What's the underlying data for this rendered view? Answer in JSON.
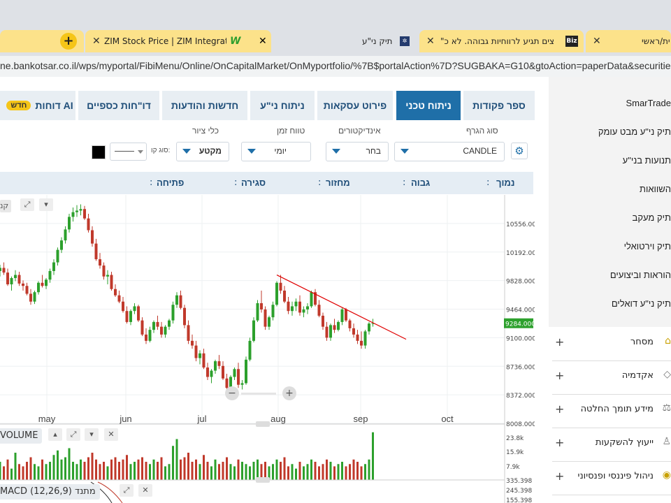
{
  "browser": {
    "tabs": [
      {
        "label": "ZIM Stock Price | ZIM Integrated",
        "icon": "w-logo-icon"
      },
      {
        "label": "תיק ני\"ע",
        "icon": "bank-logo-icon"
      },
      {
        "label": "\"צים תגיע לרווחיות גבוהה. לא כ",
        "icon": "biz-logo-icon",
        "icon_text": "Biz"
      },
      {
        "label": "ית/ראשי"
      }
    ],
    "new_tab": "+",
    "url": "ne.bankotsar.co.il/wps/myportal/FibiMenu/Online/OnCapitalMarket/OnMyportfolio/%7B$portalAction%7D?SUGBAKA=G10&gtoAction=paperData&securities"
  },
  "sidebar": {
    "links": [
      "SmarTrade",
      "תיק ני\"ע מבט עומק",
      "תנועות בני\"ע",
      "השוואות",
      "תיק מעקב",
      "תיק וירטואלי",
      "הוראות וביצועים",
      "תיק ני\"ע דואלים"
    ],
    "sections": [
      "מסחר",
      "אקדמיה",
      "מידע תומך החלטה",
      "ייעוץ להשקעות",
      "ניהול פיננסי ופנסיוני"
    ]
  },
  "main_tabs": [
    {
      "label": "ספר פקודות",
      "active": false
    },
    {
      "label": "ניתוח טכני",
      "active": true
    },
    {
      "label": "פירוט עסקאות",
      "active": false
    },
    {
      "label": "ניתוח ני\"ע",
      "active": false
    },
    {
      "label": "חדשות והודעות",
      "active": false
    },
    {
      "label": "דו\"חות כספיים",
      "active": false
    },
    {
      "label": "דוחות AI",
      "active": false,
      "badge": "חדש"
    }
  ],
  "controls": {
    "chart_type_label": "סוג הגרף",
    "chart_type_value": "CANDLE",
    "indicators_label": "אינדיקטורים",
    "indicators_value": "בחר",
    "timeframe_label": "טווח זמן",
    "timeframe_value": "יומי",
    "draw_tool_label": "כלי ציור",
    "draw_tool_value": "מקטע",
    "line_type_label": "סוג קו:",
    "line_color": "#000000"
  },
  "info_bar": {
    "symbol_label": "נמוך",
    "high_label": "גבוה",
    "volume_label": "מחזור",
    "close_label": "סגירה",
    "open_label": "פתיחה"
  },
  "chart_data": {
    "type": "candlestick",
    "price_ticks": [
      "10556.00",
      "10192.00",
      "9828.000",
      "9464.000",
      "9100.000",
      "8736.000",
      "8372.000",
      "8008.000"
    ],
    "price_ylim": [
      8008,
      10920
    ],
    "x_ticks": [
      "may",
      "jun",
      "jul",
      "aug",
      "sep",
      "oct"
    ],
    "last_price": "9284.000",
    "up_color": "#2ca02c",
    "down_color": "#c0392b",
    "trendline_color": "#e00000",
    "trendline": {
      "from": {
        "date": "jul 29",
        "price": 9900
      },
      "to": {
        "date": "sep 18",
        "price": 9080
      }
    },
    "series": [
      {
        "name": "price",
        "candles": [
          [
            9950,
            10030,
            9880,
            9990
          ],
          [
            9990,
            10060,
            9900,
            9930
          ],
          [
            9930,
            9980,
            9760,
            9780
          ],
          [
            9780,
            9880,
            9700,
            9860
          ],
          [
            9860,
            9960,
            9820,
            9900
          ],
          [
            9900,
            9940,
            9760,
            9790
          ],
          [
            9790,
            9830,
            9700,
            9760
          ],
          [
            9760,
            9800,
            9640,
            9660
          ],
          [
            9660,
            9720,
            9520,
            9560
          ],
          [
            9560,
            9700,
            9530,
            9680
          ],
          [
            9680,
            9820,
            9650,
            9800
          ],
          [
            9800,
            9900,
            9740,
            9760
          ],
          [
            9760,
            9860,
            9720,
            9840
          ],
          [
            9840,
            9980,
            9800,
            9950
          ],
          [
            9950,
            10100,
            9900,
            10060
          ],
          [
            10060,
            10250,
            10020,
            10220
          ],
          [
            10220,
            10380,
            10180,
            10340
          ],
          [
            10340,
            10520,
            10300,
            10480
          ],
          [
            10480,
            10680,
            10440,
            10640
          ],
          [
            10640,
            10760,
            10580,
            10700
          ],
          [
            10700,
            10790,
            10640,
            10720
          ],
          [
            10720,
            10800,
            10660,
            10740
          ],
          [
            10740,
            10780,
            10600,
            10620
          ],
          [
            10620,
            10680,
            10440,
            10470
          ],
          [
            10470,
            10520,
            10260,
            10300
          ],
          [
            10300,
            10360,
            10080,
            10100
          ],
          [
            10100,
            10180,
            9980,
            10020
          ],
          [
            10020,
            10060,
            9840,
            9880
          ],
          [
            9880,
            9960,
            9780,
            9900
          ],
          [
            9900,
            9940,
            9700,
            9720
          ],
          [
            9720,
            9780,
            9620,
            9640
          ],
          [
            9640,
            9700,
            9540,
            9560
          ],
          [
            9560,
            9620,
            9420,
            9440
          ],
          [
            9440,
            9500,
            9280,
            9300
          ],
          [
            9300,
            9460,
            9260,
            9440
          ],
          [
            9440,
            9540,
            9400,
            9500
          ],
          [
            9500,
            9520,
            9300,
            9320
          ],
          [
            9320,
            9360,
            9120,
            9140
          ],
          [
            9140,
            9220,
            9020,
            9060
          ],
          [
            9060,
            9240,
            9040,
            9200
          ],
          [
            9200,
            9320,
            9160,
            9300
          ],
          [
            9300,
            9380,
            9200,
            9240
          ],
          [
            9240,
            9300,
            9100,
            9140
          ],
          [
            9140,
            9260,
            9100,
            9240
          ],
          [
            9240,
            9340,
            9200,
            9320
          ],
          [
            9320,
            9560,
            9280,
            9520
          ],
          [
            9520,
            9680,
            9480,
            9640
          ],
          [
            9640,
            9700,
            9460,
            9480
          ],
          [
            9480,
            9520,
            9220,
            9260
          ],
          [
            9260,
            9320,
            9020,
            9060
          ],
          [
            9060,
            9140,
            8960,
            9000
          ],
          [
            9000,
            9060,
            8800,
            8840
          ],
          [
            8840,
            8940,
            8760,
            8900
          ],
          [
            8900,
            8960,
            8700,
            8720
          ],
          [
            8720,
            8780,
            8560,
            8600
          ],
          [
            8600,
            8700,
            8520,
            8680
          ],
          [
            8680,
            8820,
            8640,
            8800
          ],
          [
            8800,
            8880,
            8700,
            8740
          ],
          [
            8740,
            8800,
            8560,
            8580
          ],
          [
            8580,
            8640,
            8420,
            8460
          ],
          [
            8460,
            8620,
            8420,
            8600
          ],
          [
            8600,
            8720,
            8560,
            8700
          ],
          [
            8700,
            8780,
            8460,
            8500
          ],
          [
            8500,
            8560,
            8440,
            8520
          ],
          [
            8520,
            8860,
            8500,
            8820
          ],
          [
            8820,
            9100,
            8800,
            9060
          ],
          [
            9060,
            9360,
            9040,
            9320
          ],
          [
            9320,
            9580,
            9300,
            9540
          ],
          [
            9540,
            9700,
            9420,
            9460
          ],
          [
            9460,
            9500,
            9200,
            9240
          ],
          [
            9240,
            9380,
            9200,
            9360
          ],
          [
            9360,
            9560,
            9320,
            9520
          ],
          [
            9520,
            9820,
            9500,
            9800
          ],
          [
            9800,
            9900,
            9660,
            9700
          ],
          [
            9700,
            9760,
            9540,
            9560
          ],
          [
            9560,
            9620,
            9400,
            9440
          ],
          [
            9440,
            9560,
            9380,
            9500
          ],
          [
            9500,
            9600,
            9440,
            9560
          ],
          [
            9560,
            9640,
            9380,
            9420
          ],
          [
            9420,
            9500,
            9360,
            9460
          ],
          [
            9460,
            9540,
            9400,
            9500
          ],
          [
            9500,
            9700,
            9480,
            9680
          ],
          [
            9680,
            9720,
            9500,
            9520
          ],
          [
            9520,
            9580,
            9360,
            9380
          ],
          [
            9380,
            9420,
            9200,
            9240
          ],
          [
            9240,
            9300,
            9060,
            9100
          ],
          [
            9100,
            9280,
            9060,
            9260
          ],
          [
            9260,
            9340,
            9160,
            9200
          ],
          [
            9200,
            9320,
            9180,
            9300
          ],
          [
            9300,
            9480,
            9260,
            9460
          ],
          [
            9460,
            9480,
            9300,
            9320
          ],
          [
            9320,
            9340,
            9180,
            9220
          ],
          [
            9220,
            9280,
            9100,
            9140
          ],
          [
            9140,
            9200,
            9020,
            9060
          ],
          [
            9060,
            9180,
            8960,
            9000
          ],
          [
            9000,
            9200,
            8960,
            9180
          ],
          [
            9180,
            9300,
            9140,
            9280
          ],
          [
            9280,
            9340,
            9240,
            9284
          ]
        ]
      },
      {
        "name": "volume",
        "values": [
          8,
          6,
          9,
          5,
          12,
          7,
          6,
          8,
          10,
          7,
          6,
          9,
          7,
          8,
          11,
          13,
          9,
          10,
          14,
          8,
          7,
          9,
          8,
          10,
          12,
          9,
          7,
          8,
          6,
          9,
          10,
          8,
          9,
          11,
          7,
          8,
          9,
          10,
          8,
          7,
          9,
          8,
          10,
          6,
          7,
          15,
          18,
          9,
          10,
          12,
          8,
          9,
          7,
          11,
          8,
          6,
          9,
          7,
          8,
          10,
          7,
          6,
          9,
          8,
          7,
          6,
          8,
          9,
          7,
          8,
          6,
          7,
          9,
          8,
          10,
          6,
          7,
          5,
          8,
          6,
          7,
          9,
          8,
          6,
          7,
          9,
          8,
          6,
          7,
          8,
          6,
          7,
          9,
          8,
          6,
          7,
          9,
          21
        ],
        "ticks": [
          "23.8k",
          "15.9k",
          "7.9k"
        ]
      },
      {
        "name": "MACD (12,26,9)",
        "ticks": [
          "335.398",
          "245.398",
          "155.398"
        ]
      }
    ]
  },
  "chart_labels": {
    "volume": "VOLUME",
    "macd": "MACD (12,26,9) מתנד",
    "zoom_out": "−",
    "zoom_in": "+",
    "cut_label": "קנ"
  }
}
